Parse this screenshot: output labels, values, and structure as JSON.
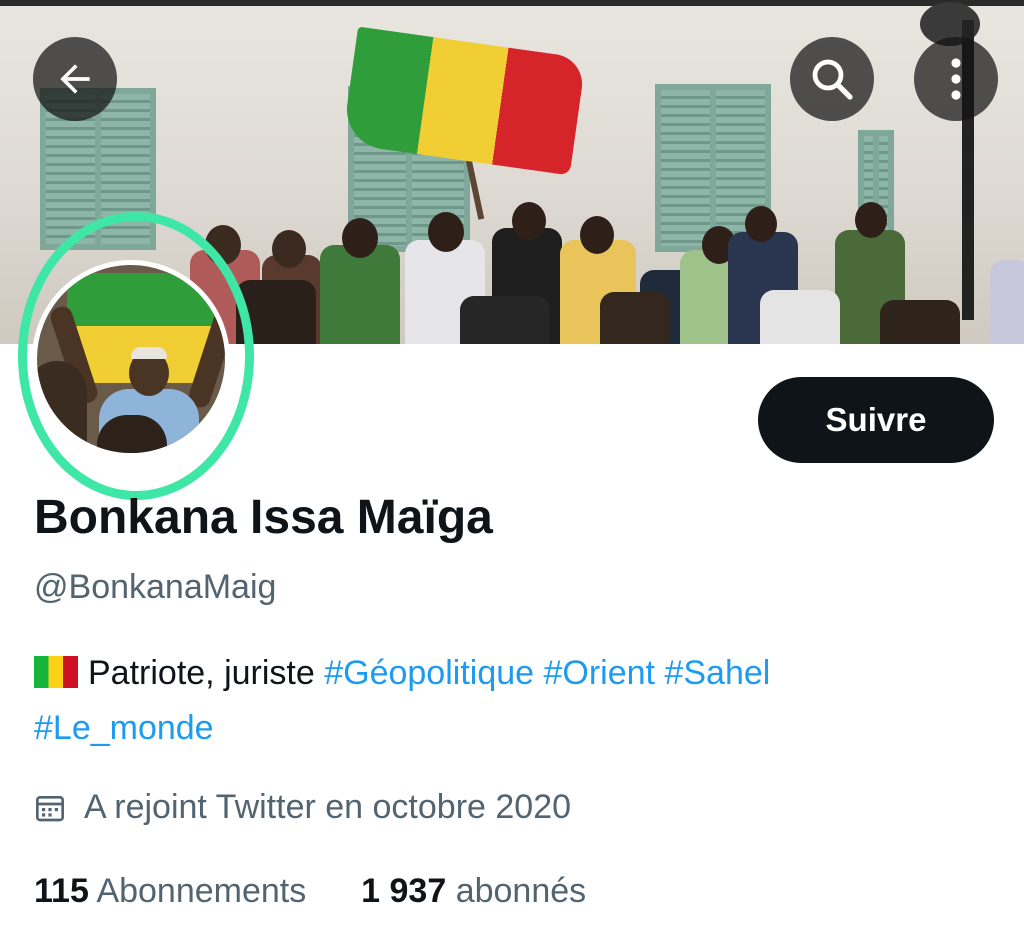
{
  "header": {
    "back_icon": "back-arrow-icon",
    "search_icon": "search-icon",
    "more_icon": "more-vertical-icon"
  },
  "profile": {
    "name": "Bonkana Issa Maïga",
    "handle": "@BonkanaMaig",
    "bio_text": "Patriote, juriste",
    "bio_flag": "mali-flag-icon",
    "hashtags": [
      "#Géopolitique",
      "#Orient",
      "#Sahel",
      "#Le_monde"
    ],
    "joined": "A rejoint Twitter en octobre 2020",
    "joined_icon": "calendar-icon",
    "following_count": "115",
    "following_label": "Abonnements",
    "followers_count": "1 937",
    "followers_label": "abonnés"
  },
  "actions": {
    "follow_label": "Suivre"
  },
  "colors": {
    "highlight_ring": "#3ee7a6",
    "hashtag": "#1d9bf0",
    "secondary_text": "#536471",
    "follow_button": "#0f1419"
  }
}
